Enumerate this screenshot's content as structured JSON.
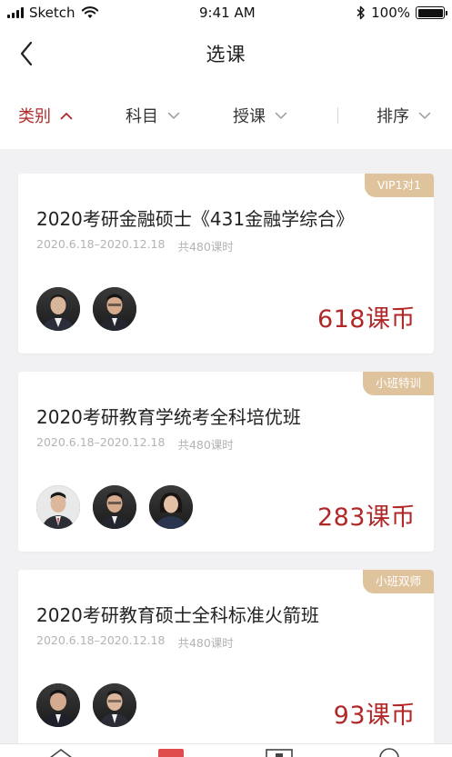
{
  "status_bar": {
    "carrier": "Sketch",
    "time": "9:41 AM",
    "battery": "100%"
  },
  "nav": {
    "title": "选课"
  },
  "filters": [
    {
      "label": "类别",
      "active": true
    },
    {
      "label": "科目",
      "active": false
    },
    {
      "label": "授课",
      "active": false
    },
    {
      "label": "排序",
      "active": false
    }
  ],
  "courses": [
    {
      "tag": "VIP1对1",
      "title": "2020考研金融硕士《431金融学综合》",
      "dates": "2020.6.18–2020.12.18",
      "hours": "共480课时",
      "teacher_count": 2,
      "price": "618课币"
    },
    {
      "tag": "小班特训",
      "title": "2020考研教育学统考全科培优班",
      "dates": "2020.6.18–2020.12.18",
      "hours": "共480课时",
      "teacher_count": 3,
      "price": "283课币"
    },
    {
      "tag": "小班双师",
      "title": "2020考研教育硕士全科标准火箭班",
      "dates": "2020.6.18–2020.12.18",
      "hours": "共480课时",
      "teacher_count": 2,
      "price": "93课币"
    }
  ],
  "colors": {
    "accent": "#b22a2a",
    "tag_bg": "#dfc39d",
    "page_bg": "#f1f1f3"
  }
}
